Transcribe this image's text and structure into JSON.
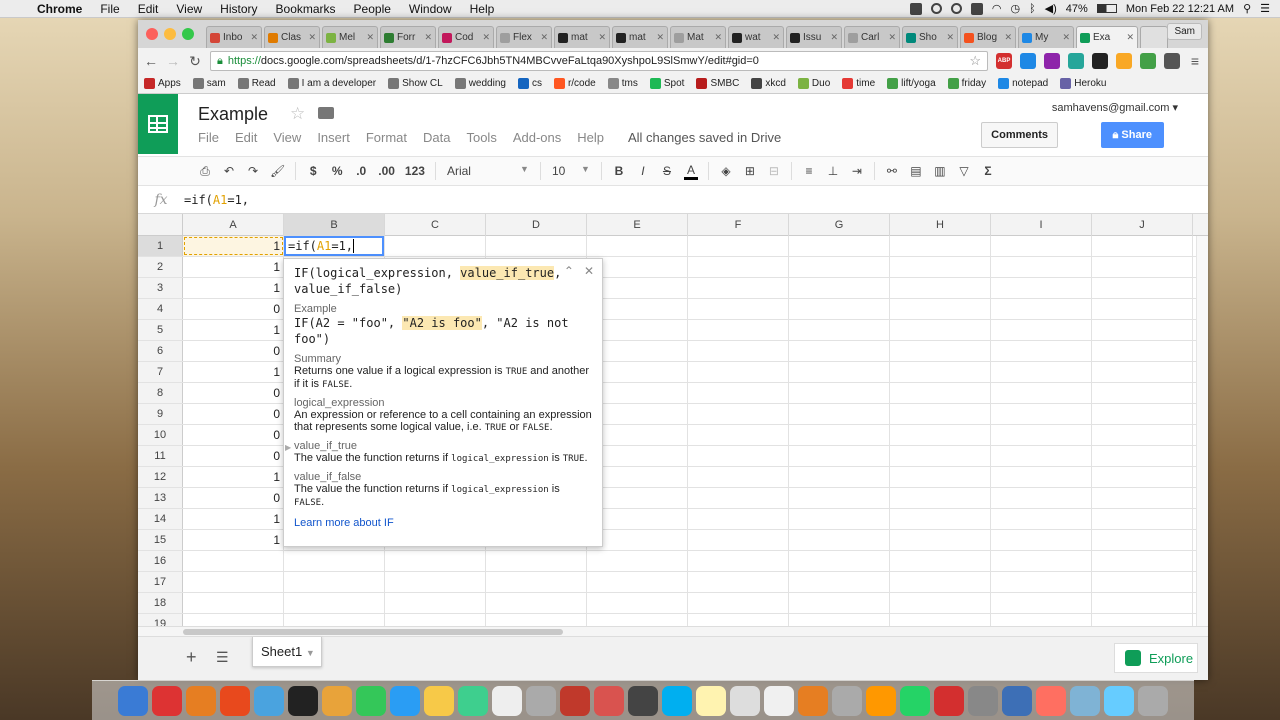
{
  "menubar": {
    "app": "Chrome",
    "items": [
      "File",
      "Edit",
      "View",
      "History",
      "Bookmarks",
      "People",
      "Window",
      "Help"
    ],
    "battery": "47%",
    "clock": "Mon Feb 22  12:21 AM"
  },
  "browser": {
    "tabs": [
      {
        "label": "Inbo",
        "color": "#d44638"
      },
      {
        "label": "Clas",
        "color": "#e07b00"
      },
      {
        "label": "Mel",
        "color": "#7cb342"
      },
      {
        "label": "Forr",
        "color": "#2e7d32"
      },
      {
        "label": "Cod",
        "color": "#c2185b"
      },
      {
        "label": "Flex",
        "color": "#9e9e9e"
      },
      {
        "label": "mat",
        "color": "#222222"
      },
      {
        "label": "mat",
        "color": "#222222"
      },
      {
        "label": "Mat",
        "color": "#9e9e9e"
      },
      {
        "label": "wat",
        "color": "#222222"
      },
      {
        "label": "Issu",
        "color": "#222222"
      },
      {
        "label": "Carl",
        "color": "#9e9e9e"
      },
      {
        "label": "Sho",
        "color": "#00897b"
      },
      {
        "label": "Blog",
        "color": "#f4511e"
      },
      {
        "label": "My",
        "color": "#1e88e5"
      },
      {
        "label": "Exa",
        "color": "#0f9d58",
        "active": true
      }
    ],
    "profile": "Sam",
    "url_https": "https://",
    "url_rest": "docs.google.com/spreadsheets/d/1-7hzCFC6Jbh5TN4MBCvveFaLtqa90XyshpoL9SlSmwY/edit#gid=0",
    "extensions": [
      "ABP"
    ],
    "bookmarks": [
      {
        "label": "Apps",
        "color": "#c62828"
      },
      {
        "label": "sam",
        "color": "#777777"
      },
      {
        "label": "Read",
        "color": "#777777"
      },
      {
        "label": "I am a developer",
        "color": "#777777"
      },
      {
        "label": "Show CL",
        "color": "#777777"
      },
      {
        "label": "wedding",
        "color": "#777777"
      },
      {
        "label": "cs",
        "color": "#1565c0"
      },
      {
        "label": "r/code",
        "color": "#ff5722"
      },
      {
        "label": "tms",
        "color": "#888888"
      },
      {
        "label": "Spot",
        "color": "#1db954"
      },
      {
        "label": "SMBC",
        "color": "#b71c1c"
      },
      {
        "label": "xkcd",
        "color": "#444444"
      },
      {
        "label": "Duo",
        "color": "#7cb342"
      },
      {
        "label": "time",
        "color": "#e53935"
      },
      {
        "label": "lift/yoga",
        "color": "#43a047"
      },
      {
        "label": "friday",
        "color": "#43a047"
      },
      {
        "label": "notepad",
        "color": "#1e88e5"
      },
      {
        "label": "Heroku",
        "color": "#6762a6"
      }
    ]
  },
  "doc": {
    "title": "Example",
    "menu": [
      "File",
      "Edit",
      "View",
      "Insert",
      "Format",
      "Data",
      "Tools",
      "Add-ons",
      "Help"
    ],
    "saved_status": "All changes saved in Drive",
    "account": "samhavens@gmail.com",
    "comments_label": "Comments",
    "share_label": "Share"
  },
  "toolbar": {
    "currency": "$",
    "percent": "%",
    "dec_decrease": ".0",
    "dec_increase": ".00",
    "format_123": "123",
    "font": "Arial",
    "font_size": "10",
    "bold": "B",
    "italic": "I",
    "strike": "S",
    "text_color": "A",
    "sigma": "Σ"
  },
  "formula_bar": {
    "fx": "fx",
    "prefix": "=if(",
    "ref": "A1",
    "suffix": "=1,"
  },
  "grid": {
    "columns": [
      "A",
      "B",
      "C",
      "D",
      "E",
      "F",
      "G",
      "H",
      "I",
      "J"
    ],
    "rows": [
      "1",
      "2",
      "3",
      "4",
      "5",
      "6",
      "7",
      "8",
      "9",
      "10",
      "11",
      "12",
      "13",
      "14",
      "15",
      "16",
      "17",
      "18",
      "19"
    ],
    "col_a": [
      "1",
      "1",
      "1",
      "0",
      "1",
      "0",
      "1",
      "0",
      "0",
      "0",
      "0",
      "1",
      "0",
      "1",
      "1",
      "",
      "",
      "",
      ""
    ]
  },
  "cell_editor": {
    "prefix": "=if(",
    "ref": "A1",
    "suffix": "=1, "
  },
  "help": {
    "sig_prefix": "IF(logical_expression, ",
    "sig_hl": "value_if_true",
    "sig_mid": ",",
    "sig_end": "value_if_false)",
    "example_label": "Example",
    "example_a": "IF(A2 = \"foo\", ",
    "example_hl": "\"A2 is foo\"",
    "example_b": ", \"A2 is not",
    "example_c": "foo\")",
    "summary_label": "Summary",
    "summary_1": "Returns one value if a logical expression is ",
    "summary_true": "TRUE",
    "summary_2": " and another",
    "summary_3": "if it is ",
    "summary_false": "FALSE",
    "summary_4": ".",
    "p1_label": "logical_expression",
    "p1_desc_1": "An expression or reference to a cell containing an expression",
    "p1_desc_2": "that represents some logical value, i.e. ",
    "p1_true": "TRUE",
    "p1_or": " or ",
    "p1_false": "FALSE",
    "p1_end": ".",
    "p2_label": "value_if_true",
    "p2_desc": "The value the function returns if ",
    "p2_code": "logical_expression",
    "p2_is": " is ",
    "p2_true": "TRUE",
    "p2_end": ".",
    "p3_label": "value_if_false",
    "p3_desc": "The value the function returns if ",
    "p3_code": "logical_expression",
    "p3_is": " is",
    "p3_false": "FALSE",
    "p3_end": ".",
    "learn_more": "Learn more about IF"
  },
  "sheets": {
    "tab": "Sheet1",
    "explore": "Explore"
  },
  "dock_colors": [
    "#3a7bd5",
    "#d33",
    "#e67e22",
    "#e8491d",
    "#4aa3df",
    "#222",
    "#e8a33a",
    "#34c759",
    "#2a9df4",
    "#f7c948",
    "#3ecf8e",
    "#eee",
    "#aaa",
    "#c0392b",
    "#d9534f",
    "#444",
    "#00aff0",
    "#fff3b0",
    "#ddd",
    "#f0f0f0",
    "#e67e22",
    "#aaa",
    "#ff9800",
    "#25d366",
    "#d32f2f",
    "#888",
    "#3d6fb6",
    "#ff6f61",
    "#7fb3d5",
    "#6cf",
    "#aaa"
  ]
}
